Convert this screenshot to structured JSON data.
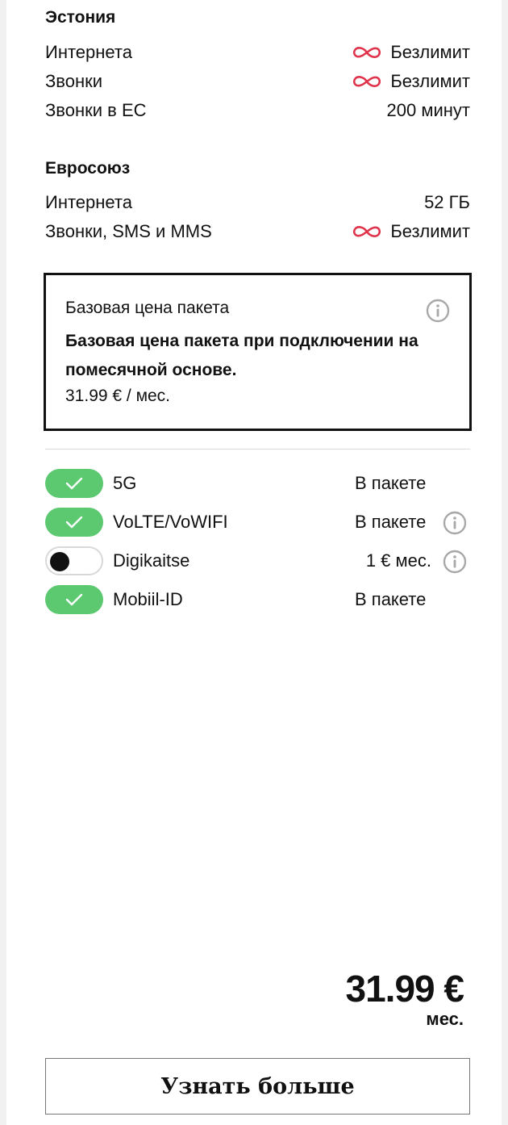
{
  "estonia": {
    "title": "Эстония",
    "rows": [
      {
        "label": "Интернета",
        "value": "Безлимит",
        "unlimited": true
      },
      {
        "label": "Звонки",
        "value": "Безлимит",
        "unlimited": true
      },
      {
        "label": "Звонки в ЕС",
        "value": "200 минут",
        "unlimited": false
      }
    ]
  },
  "eu": {
    "title": "Евросоюз",
    "rows": [
      {
        "label": "Интернета",
        "value": "52 ГБ",
        "unlimited": false
      },
      {
        "label": "Звонки, SMS и MMS",
        "value": "Безлимит",
        "unlimited": true
      }
    ]
  },
  "base_price_box": {
    "title": "Базовая цена пакета",
    "description": "Базовая цена пакета при подключении на помесячной основе.",
    "price": "31.99 € / мес."
  },
  "services": [
    {
      "name": "5G",
      "state": "В пакете",
      "enabled": true,
      "has_info": false
    },
    {
      "name": "VoLTE/VoWIFI",
      "state": "В пакете",
      "enabled": true,
      "has_info": true
    },
    {
      "name": "Digikaitse",
      "state": "1 € мес.",
      "enabled": false,
      "has_info": true
    },
    {
      "name": "Mobiil-ID",
      "state": "В пакете",
      "enabled": true,
      "has_info": false
    }
  ],
  "total": {
    "price": "31.99 €",
    "unit": "мес."
  },
  "cta_label": "Узнать больше",
  "colors": {
    "accent_unlimited": "#e0334c",
    "toggle_on": "#5cc86f",
    "background": "#f1f1f1"
  }
}
